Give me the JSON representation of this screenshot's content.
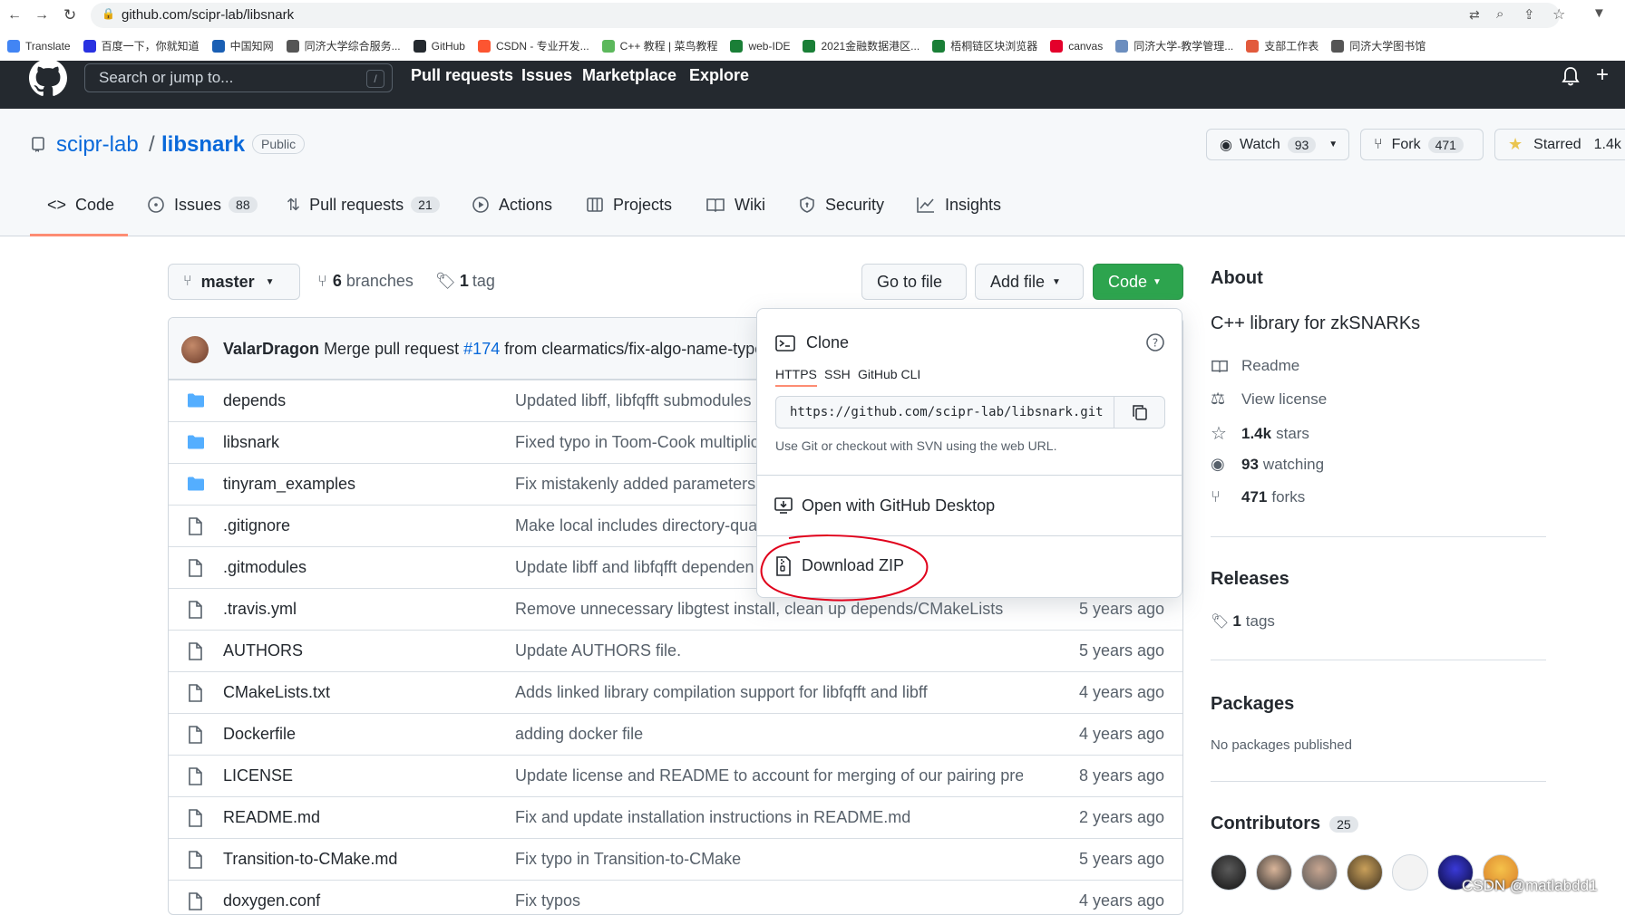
{
  "browser": {
    "url": "github.com/scipr-lab/libsnark",
    "bookmarks": [
      {
        "label": "Translate",
        "color": "#4285f4"
      },
      {
        "label": "百度一下，你就知道",
        "color": "#2932e1"
      },
      {
        "label": "中国知网",
        "color": "#1a5fb4"
      },
      {
        "label": "同济大学综合服务...",
        "color": "#555555"
      },
      {
        "label": "GitHub",
        "color": "#24292f"
      },
      {
        "label": "CSDN - 专业开发...",
        "color": "#fc5531"
      },
      {
        "label": "C++ 教程 | 菜鸟教程",
        "color": "#5cb85c"
      },
      {
        "label": "web-IDE",
        "color": "#1a7f37"
      },
      {
        "label": "2021金融数据港区...",
        "color": "#1a7f37"
      },
      {
        "label": "梧桐链区块浏览器",
        "color": "#1a7f37"
      },
      {
        "label": "canvas",
        "color": "#e4002b"
      },
      {
        "label": "同济大学-教学管理...",
        "color": "#6c8ebf"
      },
      {
        "label": "支部工作表",
        "color": "#e25a3c"
      },
      {
        "label": "同济大学图书馆",
        "color": "#555555"
      }
    ]
  },
  "header": {
    "search_placeholder": "Search or jump to...",
    "slash": "/",
    "nav": [
      "Pull requests",
      "Issues",
      "Marketplace",
      "Explore"
    ]
  },
  "repo": {
    "owner": "scipr-lab",
    "separator": "/",
    "name": "libsnark",
    "visibility": "Public",
    "watch_label": "Watch",
    "watch_count": "93",
    "fork_label": "Fork",
    "fork_count": "471",
    "star_label": "Starred",
    "star_count": "1.4k"
  },
  "tabs": [
    {
      "label": "Code",
      "count": ""
    },
    {
      "label": "Issues",
      "count": "88"
    },
    {
      "label": "Pull requests",
      "count": "21"
    },
    {
      "label": "Actions",
      "count": ""
    },
    {
      "label": "Projects",
      "count": ""
    },
    {
      "label": "Wiki",
      "count": ""
    },
    {
      "label": "Security",
      "count": ""
    },
    {
      "label": "Insights",
      "count": ""
    }
  ],
  "toolbar": {
    "branch": "master",
    "branches_count": "6",
    "branches_label": "branches",
    "tags_count": "1",
    "tags_label": "tag",
    "go_to_file": "Go to file",
    "add_file": "Add file",
    "code": "Code"
  },
  "commit": {
    "author": "ValarDragon",
    "message_pre": "Merge pull request",
    "pr": "#174",
    "message_post": "from clearmatics/fix-algo-name-typo"
  },
  "files": [
    {
      "type": "dir",
      "name": "depends",
      "message": "Updated libff, libfqfft submodules",
      "age": ""
    },
    {
      "type": "dir",
      "name": "libsnark",
      "message": "Fixed typo in Toom-Cook multiplic",
      "age": ""
    },
    {
      "type": "dir",
      "name": "tinyram_examples",
      "message": "Fix mistakenly added parameters t",
      "age": ""
    },
    {
      "type": "file",
      "name": ".gitignore",
      "message": "Make local includes directory-qual",
      "age": ""
    },
    {
      "type": "file",
      "name": ".gitmodules",
      "message": "Update libff and libfqfft dependen",
      "age": ""
    },
    {
      "type": "file",
      "name": ".travis.yml",
      "message": "Remove unnecessary libgtest install, clean up depends/CMakeLists",
      "age": "5 years ago"
    },
    {
      "type": "file",
      "name": "AUTHORS",
      "message": "Update AUTHORS file.",
      "age": "5 years ago"
    },
    {
      "type": "file",
      "name": "CMakeLists.txt",
      "message": "Adds linked library compilation support for libfqfft and libff",
      "age": "4 years ago"
    },
    {
      "type": "file",
      "name": "Dockerfile",
      "message": "adding docker file",
      "age": "4 years ago"
    },
    {
      "type": "file",
      "name": "LICENSE",
      "message": "Update license and README to account for merging of our pairing prec...",
      "age": "8 years ago"
    },
    {
      "type": "file",
      "name": "README.md",
      "message": "Fix and update installation instructions in README.md",
      "age": "2 years ago"
    },
    {
      "type": "file",
      "name": "Transition-to-CMake.md",
      "message": "Fix typo in Transition-to-CMake",
      "age": "5 years ago"
    },
    {
      "type": "file",
      "name": "doxygen.conf",
      "message": "Fix typos",
      "age": "4 years ago"
    }
  ],
  "dropdown": {
    "title": "Clone",
    "tabs": [
      "HTTPS",
      "SSH",
      "GitHub CLI"
    ],
    "url": "https://github.com/scipr-lab/libsnark.git",
    "hint": "Use Git or checkout with SVN using the web URL.",
    "open_desktop": "Open with GitHub Desktop",
    "download_zip": "Download ZIP"
  },
  "sidebar": {
    "about_title": "About",
    "description": "C++ library for zkSNARKs",
    "readme": "Readme",
    "license": "View license",
    "stars": "1.4k",
    "stars_label": "stars",
    "watching": "93",
    "watching_label": "watching",
    "forks": "471",
    "forks_label": "forks",
    "releases_title": "Releases",
    "tags_count": "1",
    "tags_label": "tags",
    "packages_title": "Packages",
    "packages_text": "No packages published",
    "contributors_title": "Contributors",
    "contributors_count": "25"
  },
  "watermark": "CSDN @matlabdd1",
  "colors": {
    "accent": "#0969da",
    "green": "#2da44e",
    "orange": "#fd8c73",
    "folder": "#54aeff",
    "annotation": "#e0001b"
  }
}
